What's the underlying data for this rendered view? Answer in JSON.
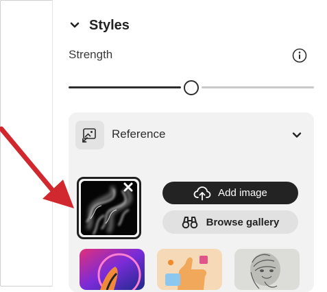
{
  "panel": {
    "styles_title": "Styles",
    "strength": {
      "label": "Strength",
      "value_fraction": 0.5
    },
    "reference": {
      "title": "Reference",
      "add_image_label": "Add image",
      "browse_gallery_label": "Browse gallery"
    }
  },
  "icons": {
    "styles_toggle": "chevron-down-icon",
    "info": "info-icon",
    "reference": "image-reference-icon",
    "reference_toggle": "chevron-down-icon",
    "remove": "close-icon",
    "upload": "cloud-upload-icon",
    "gallery": "binoculars-icon"
  },
  "colors": {
    "primary_button_bg": "#232323",
    "secondary_button_bg": "#e1e1e1",
    "card_bg": "#f2f2f2",
    "annotation_arrow": "#d0282e"
  }
}
